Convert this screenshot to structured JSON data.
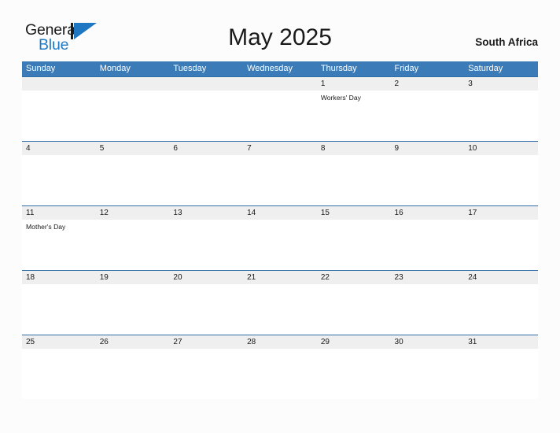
{
  "brand": {
    "name_part1": "General",
    "name_part2": "Blue",
    "mark_icon": "triangle-flag-icon",
    "accent_color": "#1e77c0"
  },
  "header": {
    "title": "May 2025",
    "region": "South Africa"
  },
  "colors": {
    "header_blue": "#3b7cb8",
    "row_divider_blue": "#2f6ea8",
    "date_strip_gray": "#efefef",
    "page_background": "#fcfcfc",
    "text": "#1a1a1a"
  },
  "calendar": {
    "month": "May",
    "year": "2025",
    "weekday_headers": [
      "Sunday",
      "Monday",
      "Tuesday",
      "Wednesday",
      "Thursday",
      "Friday",
      "Saturday"
    ],
    "weeks": [
      {
        "days": [
          {
            "date": "",
            "events": []
          },
          {
            "date": "",
            "events": []
          },
          {
            "date": "",
            "events": []
          },
          {
            "date": "",
            "events": []
          },
          {
            "date": "1",
            "events": [
              "Workers' Day"
            ]
          },
          {
            "date": "2",
            "events": []
          },
          {
            "date": "3",
            "events": []
          }
        ]
      },
      {
        "days": [
          {
            "date": "4",
            "events": []
          },
          {
            "date": "5",
            "events": []
          },
          {
            "date": "6",
            "events": []
          },
          {
            "date": "7",
            "events": []
          },
          {
            "date": "8",
            "events": []
          },
          {
            "date": "9",
            "events": []
          },
          {
            "date": "10",
            "events": []
          }
        ]
      },
      {
        "days": [
          {
            "date": "11",
            "events": [
              "Mother's Day"
            ]
          },
          {
            "date": "12",
            "events": []
          },
          {
            "date": "13",
            "events": []
          },
          {
            "date": "14",
            "events": []
          },
          {
            "date": "15",
            "events": []
          },
          {
            "date": "16",
            "events": []
          },
          {
            "date": "17",
            "events": []
          }
        ]
      },
      {
        "days": [
          {
            "date": "18",
            "events": []
          },
          {
            "date": "19",
            "events": []
          },
          {
            "date": "20",
            "events": []
          },
          {
            "date": "21",
            "events": []
          },
          {
            "date": "22",
            "events": []
          },
          {
            "date": "23",
            "events": []
          },
          {
            "date": "24",
            "events": []
          }
        ]
      },
      {
        "days": [
          {
            "date": "25",
            "events": []
          },
          {
            "date": "26",
            "events": []
          },
          {
            "date": "27",
            "events": []
          },
          {
            "date": "28",
            "events": []
          },
          {
            "date": "29",
            "events": []
          },
          {
            "date": "30",
            "events": []
          },
          {
            "date": "31",
            "events": []
          }
        ]
      }
    ]
  }
}
